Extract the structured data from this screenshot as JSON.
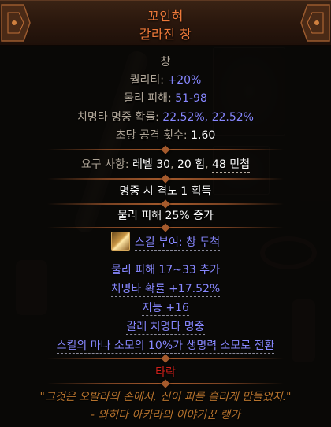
{
  "item": {
    "name_line1": "꼬인혀",
    "name_line2": "갈라진 창",
    "item_class": "창",
    "properties": [
      {
        "label": "퀄리티: ",
        "value": "+20%"
      },
      {
        "label": "물리 피해: ",
        "value": "51-98"
      },
      {
        "label": "치명타 명중 확률: ",
        "value": "22.52%, 22.52%"
      },
      {
        "label": "초당 공격 횟수: ",
        "value": "1.60"
      }
    ],
    "requirements": {
      "label": "요구 사항: ",
      "parts": [
        "레벨 30",
        ", ",
        "20 힘",
        ", ",
        "48 민첩"
      ]
    },
    "implicits": [
      {
        "text_a": "명중 시 ",
        "text_b": "격노",
        " text_c": "",
        "text_tail": " 1 획득"
      }
    ],
    "implicit2": "물리 피해 25% 증가",
    "skill_grant": "스킬 부여: 창 투척",
    "explicits": [
      "물리 피해 17~33 추가",
      "치명타 확률 +17.52%",
      "지능 +16",
      "갈래 치명타 명중",
      "스킬의 마나 소모의 10%가 생명력 소모로 전환"
    ],
    "status": "타락",
    "flavor_line1": "\"그것은 오발라의 손에서, 신이 피를 흘리게 만들었지.\"",
    "flavor_line2": "- 와히다 아카라의 이야기꾼 랭가"
  },
  "colors": {
    "unique_name": "#f07a3a",
    "magic_value": "#8888ff",
    "default_text": "#b0a698",
    "corrupted": "#d0201a",
    "flavor": "#b8742e"
  }
}
